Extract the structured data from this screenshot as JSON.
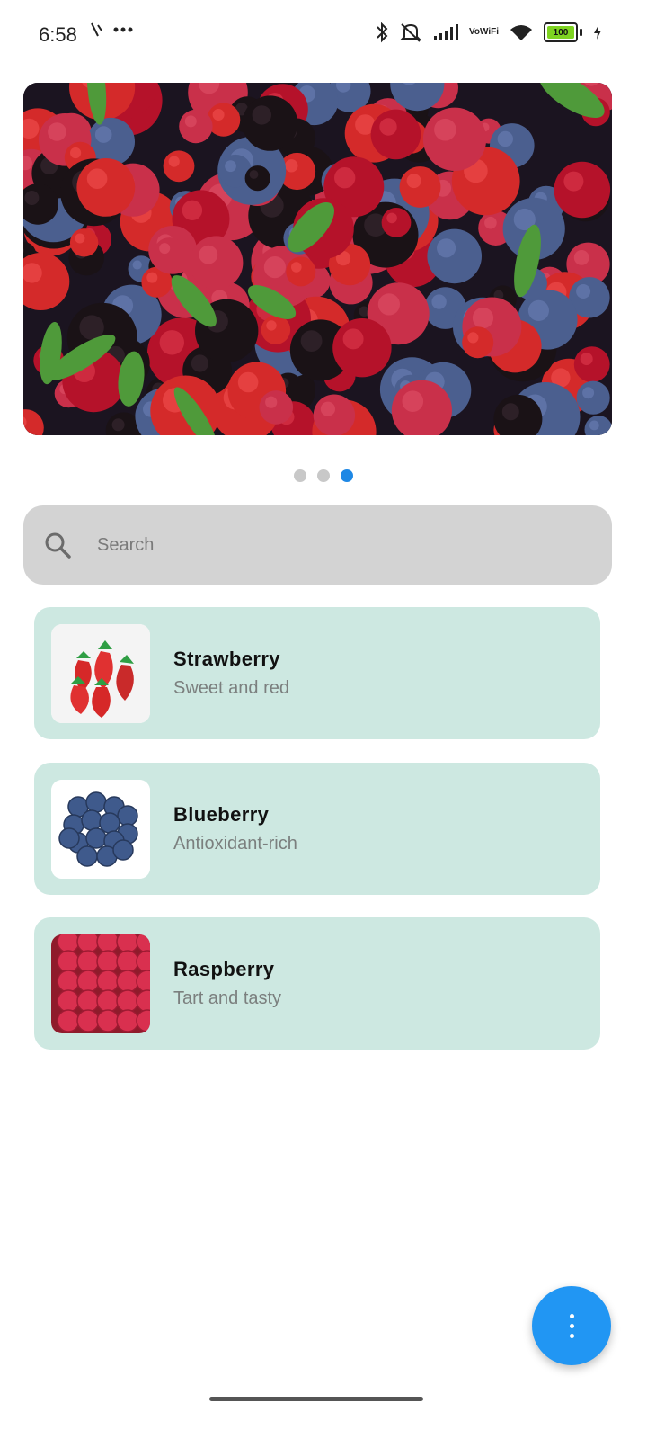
{
  "status_bar": {
    "time": "6:58",
    "battery_level": "100",
    "network_label": [
      "Vo",
      "WiFi"
    ],
    "battery_color": "#7ED321"
  },
  "banner": {
    "image": "mixed-berries-background",
    "page_indicator": {
      "count": 3,
      "active_index": 2
    }
  },
  "search": {
    "placeholder": "Search",
    "value": ""
  },
  "list": {
    "items": [
      {
        "name": "Strawberry",
        "description": "Sweet and red",
        "image": "strawberry-thumbnail"
      },
      {
        "name": "Blueberry",
        "description": "Antioxidant-rich",
        "image": "blueberry-thumbnail"
      },
      {
        "name": "Raspberry",
        "description": "Tart and tasty",
        "image": "raspberry-thumbnail"
      }
    ],
    "card_color": "#cde8e1"
  },
  "fab": {
    "icon": "more-vert-icon",
    "color": "#2196F3"
  },
  "accent_color": "#1E88E5"
}
